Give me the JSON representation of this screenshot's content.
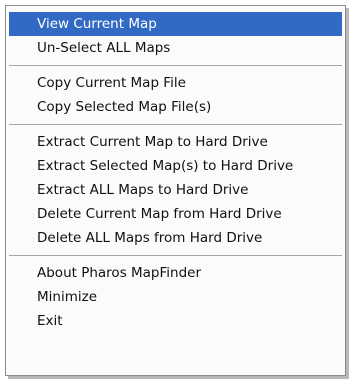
{
  "menu": {
    "groups": [
      [
        "View Current Map",
        "Un-Select ALL Maps"
      ],
      [
        "Copy Current Map File",
        "Copy Selected Map File(s)"
      ],
      [
        "Extract Current Map to Hard Drive",
        "Extract Selected Map(s) to Hard Drive",
        "Extract ALL Maps to Hard Drive",
        "Delete Current Map from Hard Drive",
        "Delete ALL Maps from Hard Drive"
      ],
      [
        "About Pharos MapFinder",
        "Minimize",
        "Exit"
      ]
    ],
    "highlighted": "View Current Map",
    "highlight_color": "#316ac5",
    "text_color": "#111111"
  }
}
